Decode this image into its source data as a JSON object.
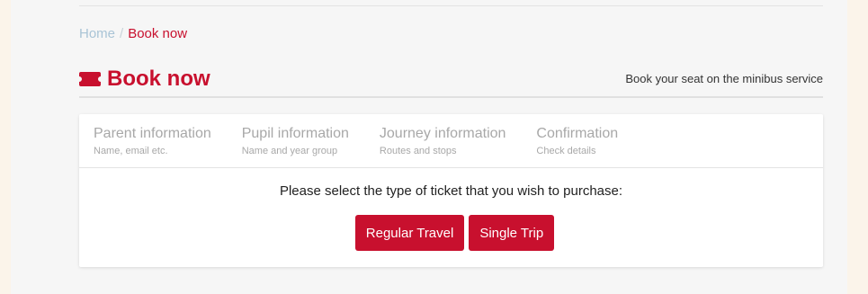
{
  "breadcrumb": {
    "home": "Home",
    "separator": "/",
    "current": "Book now"
  },
  "header": {
    "title": "Book now",
    "subtitle": "Book your seat on the minibus service",
    "icon": "ticket-icon"
  },
  "steps": [
    {
      "title": "Parent information",
      "desc": "Name, email etc."
    },
    {
      "title": "Pupil information",
      "desc": "Name and year group"
    },
    {
      "title": "Journey information",
      "desc": "Routes and stops"
    },
    {
      "title": "Confirmation",
      "desc": "Check details"
    }
  ],
  "main": {
    "prompt": "Please select the type of ticket that you wish to purchase:",
    "regular_label": "Regular Travel",
    "single_label": "Single Trip"
  },
  "colors": {
    "accent": "#c8102e",
    "background": "#f6f6f6",
    "outer": "#fbf4ea"
  }
}
